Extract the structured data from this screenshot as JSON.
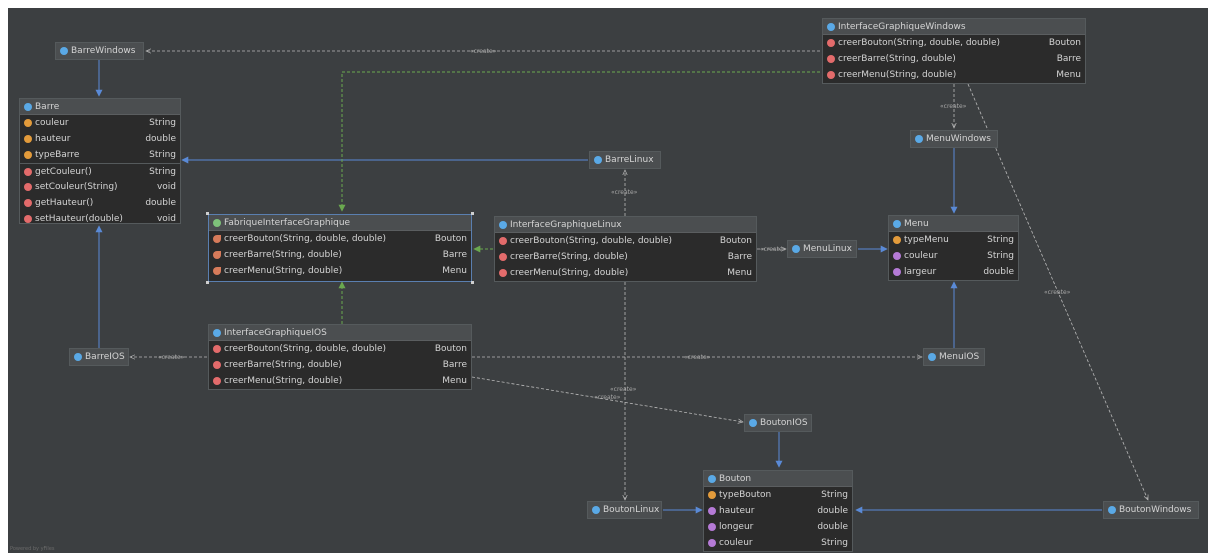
{
  "classes": {
    "barre_windows": {
      "name": "BarreWindows"
    },
    "barre": {
      "name": "Barre",
      "fields": [
        {
          "name": "couleur",
          "type": "String"
        },
        {
          "name": "hauteur",
          "type": "double"
        },
        {
          "name": "typeBarre",
          "type": "String"
        }
      ],
      "methods": [
        {
          "name": "getCouleur()",
          "type": "String"
        },
        {
          "name": "setCouleur(String)",
          "type": "void"
        },
        {
          "name": "getHauteur()",
          "type": "double"
        },
        {
          "name": "setHauteur(double)",
          "type": "void"
        }
      ]
    },
    "fabrique": {
      "name": "FabriqueInterfaceGraphique",
      "methods": [
        {
          "name": "creerBouton(String, double, double)",
          "type": "Bouton"
        },
        {
          "name": "creerBarre(String, double)",
          "type": "Barre"
        },
        {
          "name": "creerMenu(String, double)",
          "type": "Menu"
        }
      ]
    },
    "igw": {
      "name": "InterfaceGraphiqueWindows",
      "methods": [
        {
          "name": "creerBouton(String, double, double)",
          "type": "Bouton"
        },
        {
          "name": "creerBarre(String, double)",
          "type": "Barre"
        },
        {
          "name": "creerMenu(String, double)",
          "type": "Menu"
        }
      ]
    },
    "igl": {
      "name": "InterfaceGraphiqueLinux",
      "methods": [
        {
          "name": "creerBouton(String, double, double)",
          "type": "Bouton"
        },
        {
          "name": "creerBarre(String, double)",
          "type": "Barre"
        },
        {
          "name": "creerMenu(String, double)",
          "type": "Menu"
        }
      ]
    },
    "igi": {
      "name": "InterfaceGraphiqueIOS",
      "methods": [
        {
          "name": "creerBouton(String, double, double)",
          "type": "Bouton"
        },
        {
          "name": "creerBarre(String, double)",
          "type": "Barre"
        },
        {
          "name": "creerMenu(String, double)",
          "type": "Menu"
        }
      ]
    },
    "barre_linux": {
      "name": "BarreLinux"
    },
    "barre_ios": {
      "name": "BarreIOS"
    },
    "menu_windows": {
      "name": "MenuWindows"
    },
    "menu_linux": {
      "name": "MenuLinux"
    },
    "menu_ios": {
      "name": "MenuIOS"
    },
    "menu": {
      "name": "Menu",
      "fields": [
        {
          "name": "typeMenu",
          "type": "String"
        },
        {
          "name": "couleur",
          "type": "String"
        },
        {
          "name": "largeur",
          "type": "double"
        }
      ]
    },
    "bouton_ios": {
      "name": "BoutonIOS"
    },
    "bouton_linux": {
      "name": "BoutonLinux"
    },
    "bouton_windows": {
      "name": "BoutonWindows"
    },
    "bouton": {
      "name": "Bouton",
      "fields": [
        {
          "name": "typeBouton",
          "type": "String"
        },
        {
          "name": "hauteur",
          "type": "double"
        },
        {
          "name": "longeur",
          "type": "double"
        },
        {
          "name": "couleur",
          "type": "String"
        }
      ]
    }
  },
  "create_label": "«create»",
  "watermark": "Powered by yFiles",
  "colors": {
    "background": "#3c3f41",
    "box": "#2b2b2b",
    "generalization": "#5a8ad6",
    "realization": "#6aa84f",
    "dependency": "#b9b9b9"
  }
}
